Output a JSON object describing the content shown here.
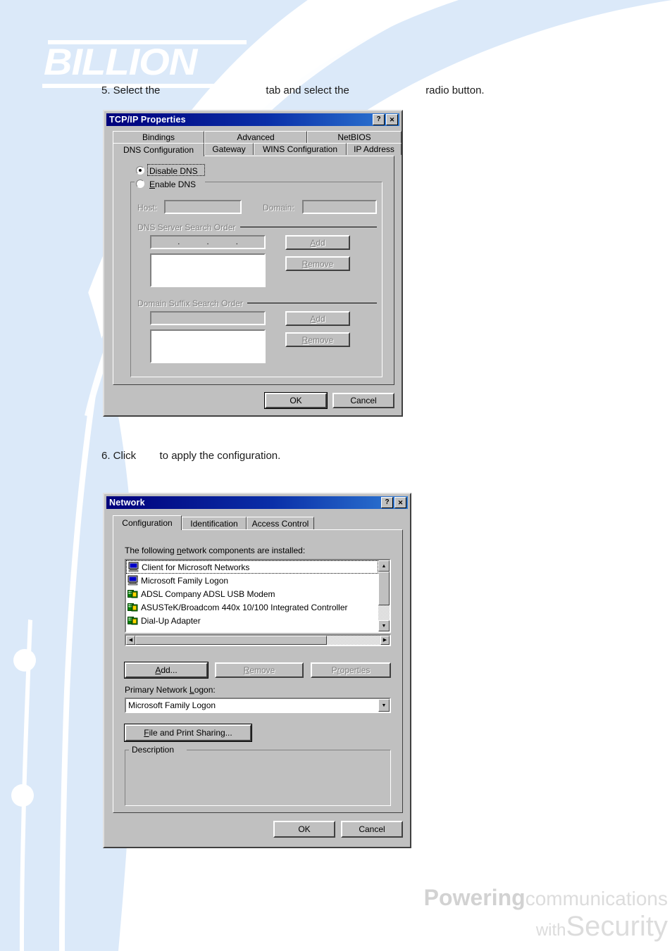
{
  "brand": {
    "logo_text": "BILLION",
    "footer_line1_bold": "Powering",
    "footer_line1_light": "communications",
    "footer_line2_small": "with",
    "footer_line2_large": "Security",
    "accent_blue": "#d6e6f7",
    "title_blue": "#00007b"
  },
  "steps": {
    "step5": "5. Select the                                    tab and select the                          radio button.",
    "step6": "6. Click        to apply the configuration."
  },
  "tcpip_dialog": {
    "title": "TCP/IP Properties",
    "help_button": "?",
    "close_button": "✕",
    "tabs_row1": [
      {
        "label": "Bindings",
        "active": false
      },
      {
        "label": "Advanced",
        "active": false
      },
      {
        "label": "NetBIOS",
        "active": false
      }
    ],
    "tabs_row2": [
      {
        "label": "DNS Configuration",
        "active": true
      },
      {
        "label": "Gateway",
        "active": false
      },
      {
        "label": "WINS Configuration",
        "active": false
      },
      {
        "label": "IP Address",
        "active": false
      }
    ],
    "radio_disable_dns": "Disable DNS",
    "radio_enable_dns": "Enable DNS",
    "selected_radio": "Disable DNS",
    "host_label": "Host:",
    "host_value": "",
    "domain_label": "Domain:",
    "domain_value": "",
    "dns_group_label": "DNS Server Search Order",
    "dns_ip_octets": [
      "",
      "",
      "",
      ""
    ],
    "dns_list_items": [],
    "dns_add_button": "Add",
    "dns_remove_button": "Remove",
    "suffix_group_label": "Domain Suffix Search Order",
    "suffix_input_value": "",
    "suffix_list_items": [],
    "suffix_add_button": "Add",
    "suffix_remove_button": "Remove",
    "ok_button": "OK",
    "cancel_button": "Cancel"
  },
  "network_dialog": {
    "title": "Network",
    "help_button": "?",
    "close_button": "✕",
    "tabs": [
      {
        "label": "Configuration",
        "active": true
      },
      {
        "label": "Identification",
        "active": false
      },
      {
        "label": "Access Control",
        "active": false
      }
    ],
    "components_label": "The following network components are installed:",
    "components": [
      {
        "name": "Client for Microsoft Networks",
        "icon": "computer-icon",
        "selected": true
      },
      {
        "name": "Microsoft Family Logon",
        "icon": "computer-icon",
        "selected": false
      },
      {
        "name": "ADSL Company ADSL USB Modem",
        "icon": "network-adapter-icon",
        "selected": false
      },
      {
        "name": "ASUSTeK/Broadcom 440x 10/100 Integrated Controller",
        "icon": "network-adapter-icon",
        "selected": false
      },
      {
        "name": "Dial-Up Adapter",
        "icon": "network-adapter-icon",
        "selected": false
      }
    ],
    "add_button": "Add...",
    "remove_button": "Remove",
    "properties_button": "Properties",
    "primary_logon_label": "Primary Network Logon:",
    "primary_logon_value": "Microsoft Family Logon",
    "file_print_sharing_button": "File and Print Sharing...",
    "description_label": "Description",
    "description_text": "",
    "ok_button": "OK",
    "cancel_button": "Cancel"
  }
}
